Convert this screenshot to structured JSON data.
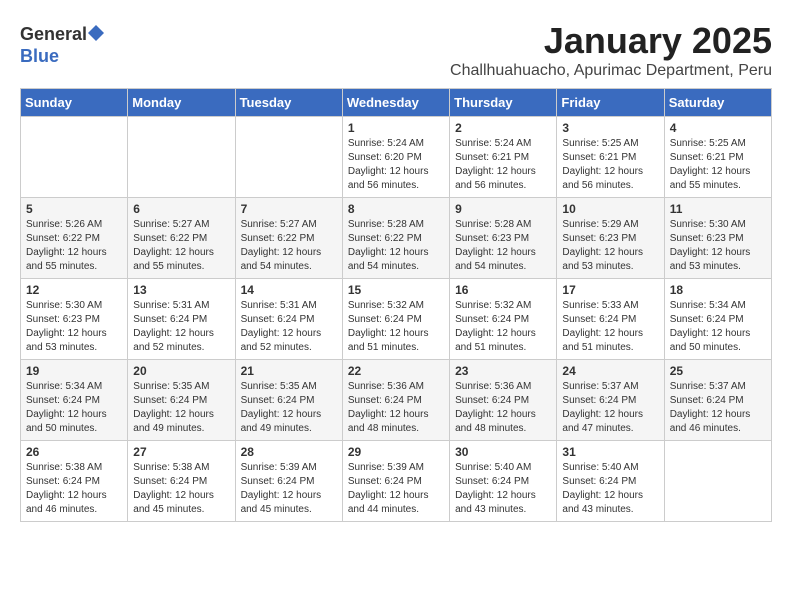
{
  "logo": {
    "general": "General",
    "blue": "Blue"
  },
  "title": "January 2025",
  "subtitle": "Challhuahuacho, Apurimac Department, Peru",
  "weekdays": [
    "Sunday",
    "Monday",
    "Tuesday",
    "Wednesday",
    "Thursday",
    "Friday",
    "Saturday"
  ],
  "weeks": [
    [
      {
        "day": "",
        "sunrise": "",
        "sunset": "",
        "daylight": ""
      },
      {
        "day": "",
        "sunrise": "",
        "sunset": "",
        "daylight": ""
      },
      {
        "day": "",
        "sunrise": "",
        "sunset": "",
        "daylight": ""
      },
      {
        "day": "1",
        "sunrise": "Sunrise: 5:24 AM",
        "sunset": "Sunset: 6:20 PM",
        "daylight": "Daylight: 12 hours and 56 minutes."
      },
      {
        "day": "2",
        "sunrise": "Sunrise: 5:24 AM",
        "sunset": "Sunset: 6:21 PM",
        "daylight": "Daylight: 12 hours and 56 minutes."
      },
      {
        "day": "3",
        "sunrise": "Sunrise: 5:25 AM",
        "sunset": "Sunset: 6:21 PM",
        "daylight": "Daylight: 12 hours and 56 minutes."
      },
      {
        "day": "4",
        "sunrise": "Sunrise: 5:25 AM",
        "sunset": "Sunset: 6:21 PM",
        "daylight": "Daylight: 12 hours and 55 minutes."
      }
    ],
    [
      {
        "day": "5",
        "sunrise": "Sunrise: 5:26 AM",
        "sunset": "Sunset: 6:22 PM",
        "daylight": "Daylight: 12 hours and 55 minutes."
      },
      {
        "day": "6",
        "sunrise": "Sunrise: 5:27 AM",
        "sunset": "Sunset: 6:22 PM",
        "daylight": "Daylight: 12 hours and 55 minutes."
      },
      {
        "day": "7",
        "sunrise": "Sunrise: 5:27 AM",
        "sunset": "Sunset: 6:22 PM",
        "daylight": "Daylight: 12 hours and 54 minutes."
      },
      {
        "day": "8",
        "sunrise": "Sunrise: 5:28 AM",
        "sunset": "Sunset: 6:22 PM",
        "daylight": "Daylight: 12 hours and 54 minutes."
      },
      {
        "day": "9",
        "sunrise": "Sunrise: 5:28 AM",
        "sunset": "Sunset: 6:23 PM",
        "daylight": "Daylight: 12 hours and 54 minutes."
      },
      {
        "day": "10",
        "sunrise": "Sunrise: 5:29 AM",
        "sunset": "Sunset: 6:23 PM",
        "daylight": "Daylight: 12 hours and 53 minutes."
      },
      {
        "day": "11",
        "sunrise": "Sunrise: 5:30 AM",
        "sunset": "Sunset: 6:23 PM",
        "daylight": "Daylight: 12 hours and 53 minutes."
      }
    ],
    [
      {
        "day": "12",
        "sunrise": "Sunrise: 5:30 AM",
        "sunset": "Sunset: 6:23 PM",
        "daylight": "Daylight: 12 hours and 53 minutes."
      },
      {
        "day": "13",
        "sunrise": "Sunrise: 5:31 AM",
        "sunset": "Sunset: 6:24 PM",
        "daylight": "Daylight: 12 hours and 52 minutes."
      },
      {
        "day": "14",
        "sunrise": "Sunrise: 5:31 AM",
        "sunset": "Sunset: 6:24 PM",
        "daylight": "Daylight: 12 hours and 52 minutes."
      },
      {
        "day": "15",
        "sunrise": "Sunrise: 5:32 AM",
        "sunset": "Sunset: 6:24 PM",
        "daylight": "Daylight: 12 hours and 51 minutes."
      },
      {
        "day": "16",
        "sunrise": "Sunrise: 5:32 AM",
        "sunset": "Sunset: 6:24 PM",
        "daylight": "Daylight: 12 hours and 51 minutes."
      },
      {
        "day": "17",
        "sunrise": "Sunrise: 5:33 AM",
        "sunset": "Sunset: 6:24 PM",
        "daylight": "Daylight: 12 hours and 51 minutes."
      },
      {
        "day": "18",
        "sunrise": "Sunrise: 5:34 AM",
        "sunset": "Sunset: 6:24 PM",
        "daylight": "Daylight: 12 hours and 50 minutes."
      }
    ],
    [
      {
        "day": "19",
        "sunrise": "Sunrise: 5:34 AM",
        "sunset": "Sunset: 6:24 PM",
        "daylight": "Daylight: 12 hours and 50 minutes."
      },
      {
        "day": "20",
        "sunrise": "Sunrise: 5:35 AM",
        "sunset": "Sunset: 6:24 PM",
        "daylight": "Daylight: 12 hours and 49 minutes."
      },
      {
        "day": "21",
        "sunrise": "Sunrise: 5:35 AM",
        "sunset": "Sunset: 6:24 PM",
        "daylight": "Daylight: 12 hours and 49 minutes."
      },
      {
        "day": "22",
        "sunrise": "Sunrise: 5:36 AM",
        "sunset": "Sunset: 6:24 PM",
        "daylight": "Daylight: 12 hours and 48 minutes."
      },
      {
        "day": "23",
        "sunrise": "Sunrise: 5:36 AM",
        "sunset": "Sunset: 6:24 PM",
        "daylight": "Daylight: 12 hours and 48 minutes."
      },
      {
        "day": "24",
        "sunrise": "Sunrise: 5:37 AM",
        "sunset": "Sunset: 6:24 PM",
        "daylight": "Daylight: 12 hours and 47 minutes."
      },
      {
        "day": "25",
        "sunrise": "Sunrise: 5:37 AM",
        "sunset": "Sunset: 6:24 PM",
        "daylight": "Daylight: 12 hours and 46 minutes."
      }
    ],
    [
      {
        "day": "26",
        "sunrise": "Sunrise: 5:38 AM",
        "sunset": "Sunset: 6:24 PM",
        "daylight": "Daylight: 12 hours and 46 minutes."
      },
      {
        "day": "27",
        "sunrise": "Sunrise: 5:38 AM",
        "sunset": "Sunset: 6:24 PM",
        "daylight": "Daylight: 12 hours and 45 minutes."
      },
      {
        "day": "28",
        "sunrise": "Sunrise: 5:39 AM",
        "sunset": "Sunset: 6:24 PM",
        "daylight": "Daylight: 12 hours and 45 minutes."
      },
      {
        "day": "29",
        "sunrise": "Sunrise: 5:39 AM",
        "sunset": "Sunset: 6:24 PM",
        "daylight": "Daylight: 12 hours and 44 minutes."
      },
      {
        "day": "30",
        "sunrise": "Sunrise: 5:40 AM",
        "sunset": "Sunset: 6:24 PM",
        "daylight": "Daylight: 12 hours and 43 minutes."
      },
      {
        "day": "31",
        "sunrise": "Sunrise: 5:40 AM",
        "sunset": "Sunset: 6:24 PM",
        "daylight": "Daylight: 12 hours and 43 minutes."
      },
      {
        "day": "",
        "sunrise": "",
        "sunset": "",
        "daylight": ""
      }
    ]
  ]
}
